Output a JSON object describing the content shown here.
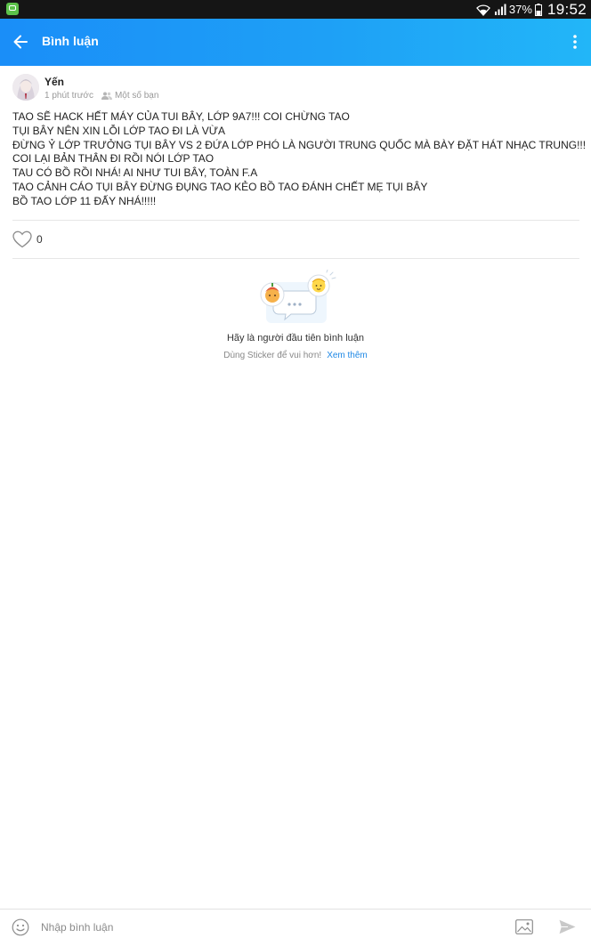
{
  "status_bar": {
    "battery": "37%",
    "time": "19:52",
    "icons": [
      "app-icon",
      "wifi-icon",
      "signal-icon",
      "battery-icon"
    ]
  },
  "header": {
    "title": "Bình luận",
    "back_icon": "arrow-left-icon",
    "menu_icon": "more-vertical-icon",
    "colors": {
      "start": "#1a8ef8",
      "end": "#22b6f8"
    }
  },
  "post": {
    "author": "Yến",
    "time": "1 phút trước",
    "privacy": "Một số bạn",
    "lines": [
      "TAO SẼ HACK HẾT MÁY CỦA TUI BÂY, LỚP 9A7!!! COI CHỪNG TAO",
      "TỤI BÂY NÊN XIN LỖI LỚP TAO ĐI LÀ VỪA",
      "ĐỪNG Ỷ LỚP TRƯỞNG TỤI BÂY VS 2 ĐỨA LỚP PHÓ LÀ NGƯỜI TRUNG QUỐC MÀ BÀY ĐẶT HÁT NHẠC TRUNG!!!",
      "COI LẠI BẢN THÂN ĐI RỒI NÓI LỚP TAO",
      "TAU CÓ BỒ RỒI NHÁ! AI NHƯ TUI BÂY, TOÀN F.A",
      "TAO CẢNH CÁO TỤI BÂY ĐỪNG ĐỤNG TAO KẺO BỒ TAO ĐÁNH CHẾT MẸ TỤI BÂY",
      "BỒ TAO LỚP 11 ĐẤY NHÁ!!!!!"
    ],
    "likes": "0"
  },
  "empty_state": {
    "title": "Hãy là người đầu tiên bình luận",
    "subtitle": "Dùng Sticker để vui hơn!",
    "link": "Xem thêm"
  },
  "comment_bar": {
    "placeholder": "Nhập bình luận",
    "icons": [
      "emoji-icon",
      "image-icon",
      "send-icon"
    ]
  }
}
